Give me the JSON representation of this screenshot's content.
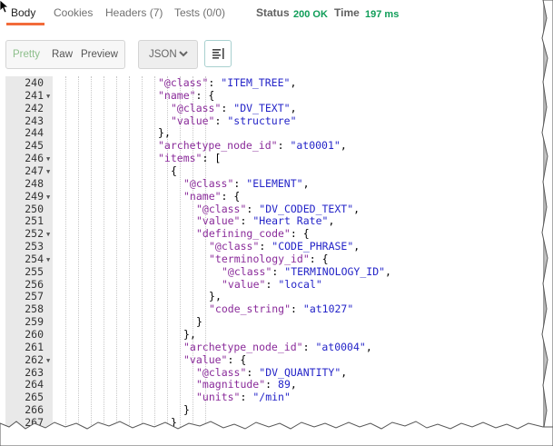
{
  "tabs": [
    "Body",
    "Cookies",
    "Headers (7)",
    "Tests (0/0)"
  ],
  "status": {
    "label": "Status",
    "value": "200 OK",
    "time_label": "Time",
    "time_value": "197 ms"
  },
  "view_modes": [
    "Pretty",
    "Raw",
    "Preview"
  ],
  "format_select": "JSON",
  "wrap_icon": "wrap-lines-icon",
  "colors": {
    "accent": "#f26b3a",
    "status_ok": "#0f9d58",
    "json_key": "#8a2b9a",
    "json_string": "#2424c8"
  },
  "code_lines": [
    {
      "n": "240",
      "fold": false,
      "indent": 8,
      "text": "\"@class\": \"ITEM_TREE\","
    },
    {
      "n": "241",
      "fold": true,
      "indent": 8,
      "text": "\"name\": {"
    },
    {
      "n": "242",
      "fold": false,
      "indent": 9,
      "text": "\"@class\": \"DV_TEXT\","
    },
    {
      "n": "243",
      "fold": false,
      "indent": 9,
      "text": "\"value\": \"structure\""
    },
    {
      "n": "244",
      "fold": false,
      "indent": 8,
      "text": "},"
    },
    {
      "n": "245",
      "fold": false,
      "indent": 8,
      "text": "\"archetype_node_id\": \"at0001\","
    },
    {
      "n": "246",
      "fold": true,
      "indent": 8,
      "text": "\"items\": ["
    },
    {
      "n": "247",
      "fold": true,
      "indent": 9,
      "text": "{"
    },
    {
      "n": "248",
      "fold": false,
      "indent": 10,
      "text": "\"@class\": \"ELEMENT\","
    },
    {
      "n": "249",
      "fold": true,
      "indent": 10,
      "text": "\"name\": {"
    },
    {
      "n": "250",
      "fold": false,
      "indent": 11,
      "text": "\"@class\": \"DV_CODED_TEXT\","
    },
    {
      "n": "251",
      "fold": false,
      "indent": 11,
      "text": "\"value\": \"Heart Rate\","
    },
    {
      "n": "252",
      "fold": true,
      "indent": 11,
      "text": "\"defining_code\": {"
    },
    {
      "n": "253",
      "fold": false,
      "indent": 12,
      "text": "\"@class\": \"CODE_PHRASE\","
    },
    {
      "n": "254",
      "fold": true,
      "indent": 12,
      "text": "\"terminology_id\": {"
    },
    {
      "n": "255",
      "fold": false,
      "indent": 13,
      "text": "\"@class\": \"TERMINOLOGY_ID\","
    },
    {
      "n": "256",
      "fold": false,
      "indent": 13,
      "text": "\"value\": \"local\""
    },
    {
      "n": "257",
      "fold": false,
      "indent": 12,
      "text": "},"
    },
    {
      "n": "258",
      "fold": false,
      "indent": 12,
      "text": "\"code_string\": \"at1027\""
    },
    {
      "n": "259",
      "fold": false,
      "indent": 11,
      "text": "}"
    },
    {
      "n": "260",
      "fold": false,
      "indent": 10,
      "text": "},"
    },
    {
      "n": "261",
      "fold": false,
      "indent": 10,
      "text": "\"archetype_node_id\": \"at0004\","
    },
    {
      "n": "262",
      "fold": true,
      "indent": 10,
      "text": "\"value\": {"
    },
    {
      "n": "263",
      "fold": false,
      "indent": 11,
      "text": "\"@class\": \"DV_QUANTITY\","
    },
    {
      "n": "264",
      "fold": false,
      "indent": 11,
      "text": "\"magnitude\": 89,"
    },
    {
      "n": "265",
      "fold": false,
      "indent": 11,
      "text": "\"units\": \"/min\""
    },
    {
      "n": "266",
      "fold": false,
      "indent": 10,
      "text": "}"
    },
    {
      "n": "267",
      "fold": false,
      "indent": 9,
      "text": "}"
    }
  ]
}
